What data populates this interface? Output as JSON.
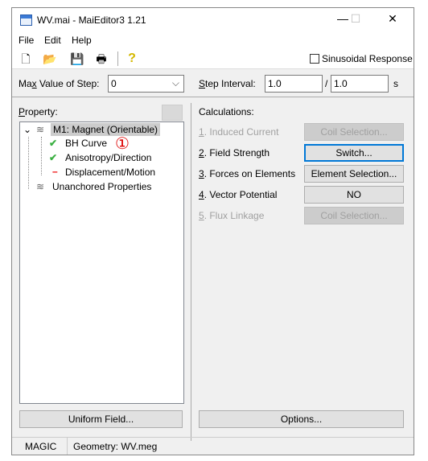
{
  "window": {
    "title": "WV.mai - MaiEditor3 1.21",
    "minimize": "—",
    "maximize": "☐",
    "close": "✕"
  },
  "menu": [
    "File",
    "Edit",
    "Help"
  ],
  "toolbar": {
    "icons": [
      "new-file-icon",
      "open-folder-icon",
      "save-icon",
      "print-icon",
      "help-icon"
    ],
    "sinusoidal_label": "Sinusoidal Response",
    "sinusoidal_checked": false
  },
  "step": {
    "max_label_pre": "Ma",
    "max_label_u": "x",
    "max_label_post": " Value of Step:",
    "max_value": "0",
    "interval_label_u": "S",
    "interval_label_post": "tep Interval:",
    "interval_value": "1.0",
    "divider": "/",
    "interval_denom": "1.0",
    "unit": "s"
  },
  "property": {
    "label_u": "P",
    "label_post": "roperty:",
    "tree": {
      "root": "M1: Magnet (Orientable)",
      "children": [
        "BH Curve",
        "Anisotropy/Direction",
        "Displacement/Motion"
      ],
      "sibling": "Unanchored Properties"
    },
    "annotation": "①",
    "uniform_button": "Uniform Field..."
  },
  "calculations": {
    "label": "Calculations:",
    "items": [
      {
        "num": "1",
        "text": ". Induced Current",
        "button": "Coil Selection...",
        "enabled": false
      },
      {
        "num": "2",
        "text": ". Field Strength",
        "button": "Switch...",
        "enabled": true
      },
      {
        "num": "3",
        "text": ". Forces on Elements",
        "button": "Element Selection...",
        "enabled": true
      },
      {
        "num": "4",
        "text": ". Vector Potential",
        "button": "NO",
        "enabled": true
      },
      {
        "num": "5",
        "text": ". Flux Linkage",
        "button": "Coil Selection...",
        "enabled": false
      }
    ],
    "options_button": "Options..."
  },
  "status": {
    "left": "MAGIC",
    "right": "Geometry: WV.meg"
  }
}
